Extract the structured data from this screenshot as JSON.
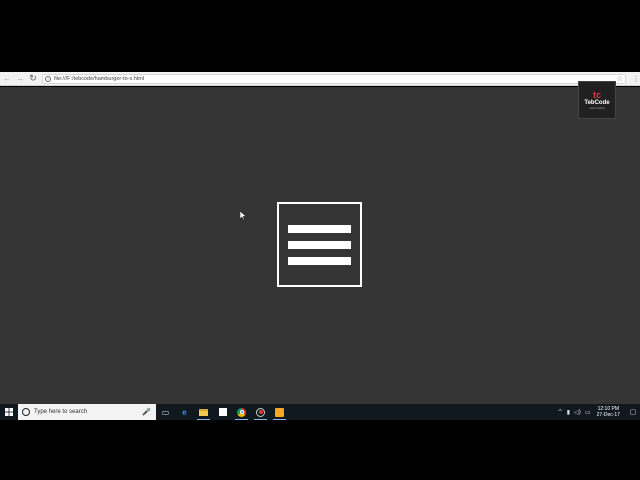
{
  "browser": {
    "url": "file:///F:/tebcode/hamburger-to-x.html",
    "back_icon": "←",
    "forward_icon": "→",
    "reload_icon": "↻",
    "info_icon": "i",
    "star_icon": "☆",
    "menu_icon": "⋮"
  },
  "watermark": {
    "mark": "tc",
    "name": "TebCode",
    "tagline": "Learn Coding"
  },
  "taskbar": {
    "search_placeholder": "Type here to search",
    "mic_icon": "🎤",
    "task_view_icon": "▭",
    "edge_label": "e",
    "tray_chevron": "^",
    "tray_network": "▮",
    "tray_volume": "◁)",
    "tray_lang": "▭",
    "time": "12:10 PM",
    "date": "27-Dec-17",
    "notification_icon": "▢"
  },
  "colors": {
    "page_background": "#353535",
    "hamburger": "#ffffff",
    "taskbar": "#101820"
  }
}
